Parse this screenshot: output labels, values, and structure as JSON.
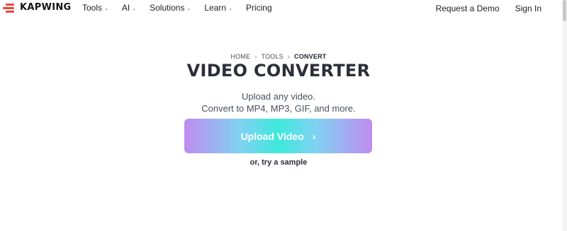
{
  "header": {
    "brand": "KAPWING",
    "menu": [
      {
        "label": "Tools",
        "has_dropdown": true
      },
      {
        "label": "AI",
        "has_dropdown": true
      },
      {
        "label": "Solutions",
        "has_dropdown": true
      },
      {
        "label": "Learn",
        "has_dropdown": true
      },
      {
        "label": "Pricing",
        "has_dropdown": false
      }
    ],
    "request_demo": "Request a Demo",
    "sign_in": "Sign In",
    "chevron": "⌄"
  },
  "breadcrumb": {
    "items": [
      "HOME",
      "TOOLS",
      "CONVERT"
    ],
    "separator": "›"
  },
  "main": {
    "title": "VIDEO CONVERTER",
    "subtitle_line1": "Upload any video.",
    "subtitle_line2": "Convert to MP4, MP3, GIF, and more.",
    "upload_label": "Upload Video",
    "upload_chevron": "›",
    "sample_label": "or, try a sample"
  },
  "colors": {
    "brand": "#f2453d",
    "gradient_left": "#c08cf0",
    "gradient_center": "#3fe8dc",
    "text_dark": "#2c2f3a"
  }
}
